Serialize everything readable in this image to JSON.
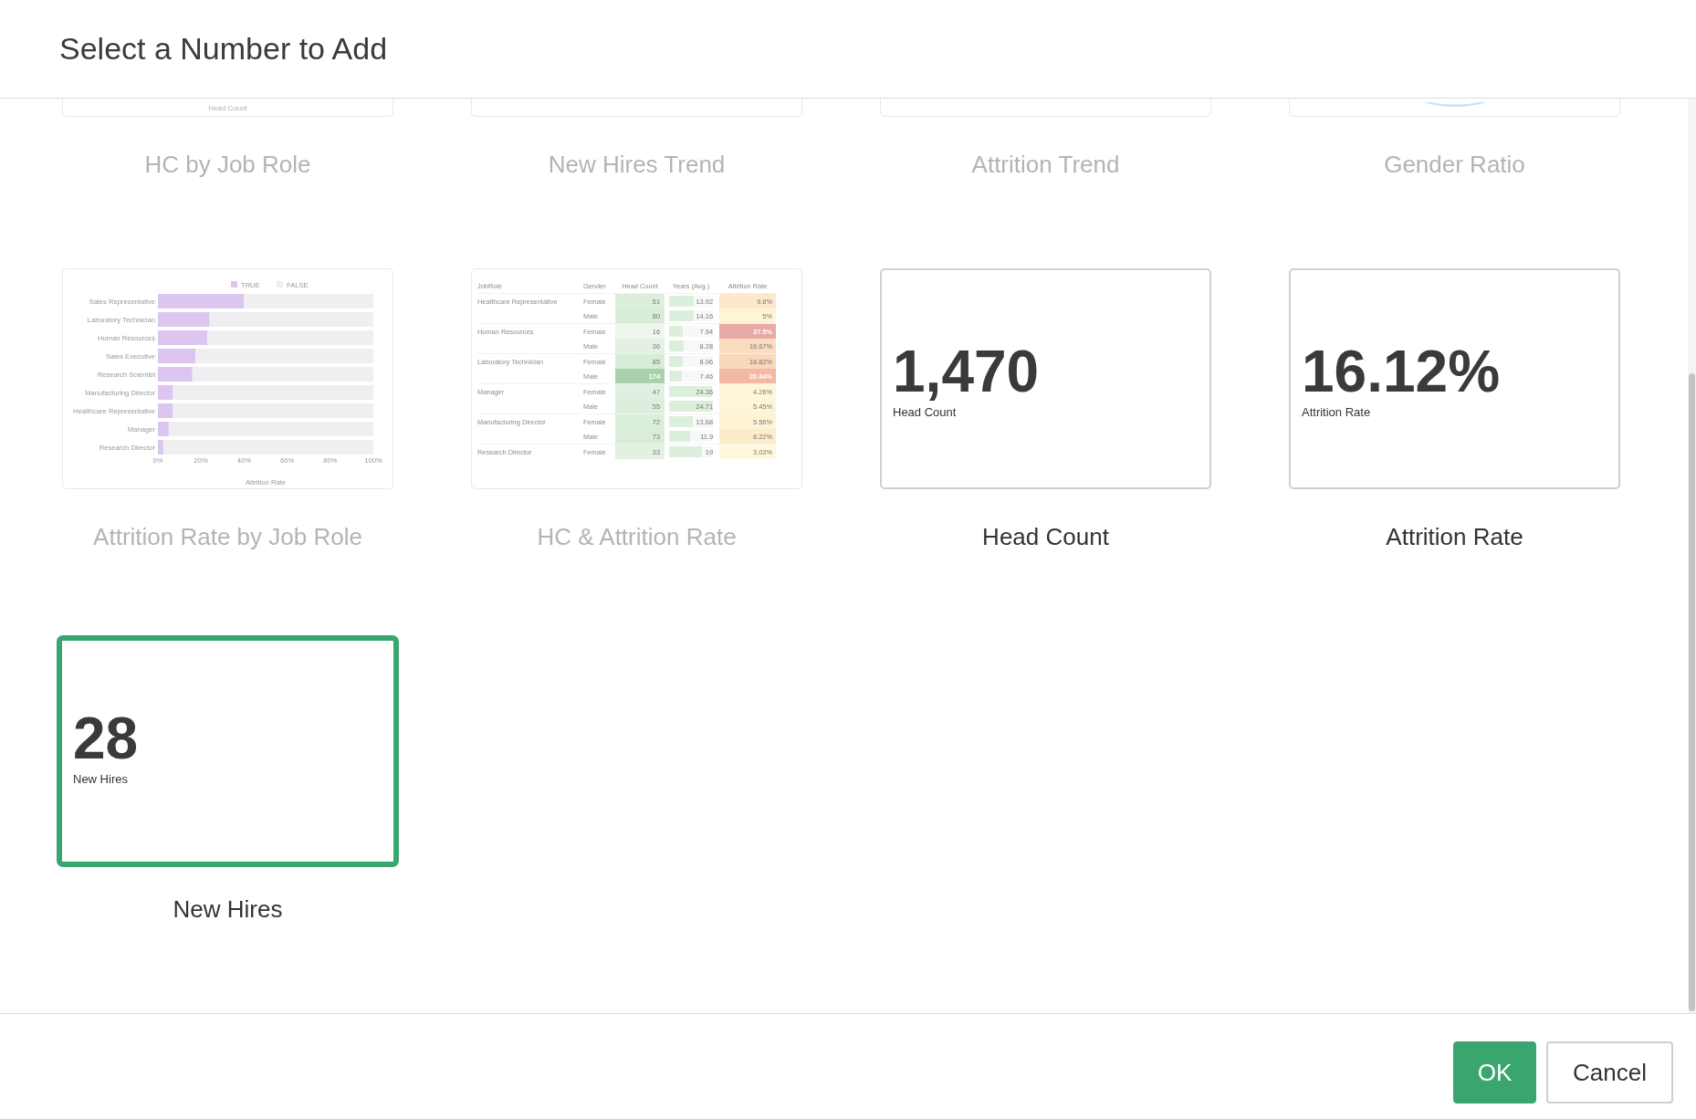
{
  "dialog": {
    "title": "Select a Number to Add"
  },
  "cards": [
    {
      "title": "HC by Job Role",
      "kind": "cut_text",
      "caption": "Head Count",
      "disabled": true,
      "selected": false
    },
    {
      "title": "New Hires Trend",
      "kind": "cut_blank",
      "disabled": true,
      "selected": false
    },
    {
      "title": "Attrition Trend",
      "kind": "cut_blank",
      "disabled": true,
      "selected": false
    },
    {
      "title": "Gender Ratio",
      "kind": "cut_donut",
      "disabled": true,
      "selected": false
    },
    {
      "title": "Attrition Rate by Job Role",
      "kind": "bar_chart",
      "disabled": true,
      "selected": false,
      "chart_data": {
        "type": "bar",
        "orientation": "horizontal",
        "stacked": true,
        "legend": true,
        "xlabel": "Attrition Rate",
        "categories": [
          "Sales Representative",
          "Laboratory Technician",
          "Human Resources",
          "Sales Executive",
          "Research Scientist",
          "Manufacturing Director",
          "Healthcare Representative",
          "Manager",
          "Research Director"
        ],
        "series": [
          {
            "name": "TRUE",
            "color": "#dcc6f0",
            "values": [
              40,
              24,
              23,
              17.5,
              16,
              7,
              7,
              5,
              2.5
            ]
          },
          {
            "name": "FALSE",
            "color": "#efeff1",
            "values": [
              60,
              76,
              77,
              82.5,
              84,
              93,
              93,
              95,
              97.5
            ]
          }
        ],
        "xlim": [
          0,
          100
        ],
        "xticks": [
          {
            "value": 0,
            "label": "0%"
          },
          {
            "value": 20,
            "label": "20%"
          },
          {
            "value": 40,
            "label": "40%"
          },
          {
            "value": 60,
            "label": "60%"
          },
          {
            "value": 80,
            "label": "80%"
          },
          {
            "value": 100,
            "label": "100%"
          }
        ]
      }
    },
    {
      "title": "HC & Attrition Rate",
      "kind": "table",
      "disabled": true,
      "selected": false,
      "table": {
        "columns": [
          "JobRole",
          "Gender",
          "Head Count",
          "Years (Avg.)",
          "Attrition Rate"
        ],
        "rows": [
          {
            "job_role": "Healthcare Representative",
            "gender": "Female",
            "head_count": {
              "text": "51",
              "color": "#dcefdc",
              "dark": false
            },
            "years": {
              "text": "13.92",
              "level": 0.56
            },
            "attrition": {
              "text": "9.8%",
              "color": "#fde9c9",
              "dark": false
            }
          },
          {
            "gender": "Male",
            "head_count": {
              "text": "80",
              "color": "#d8edd8",
              "dark": false
            },
            "years": {
              "text": "14.16",
              "level": 0.57
            },
            "attrition": {
              "text": "5%",
              "color": "#fef5d6",
              "dark": false
            }
          },
          {
            "job_role": "Human Resources",
            "gender": "Female",
            "head_count": {
              "text": "16",
              "color": "#eef6ee",
              "dark": false
            },
            "years": {
              "text": "7.94",
              "level": 0.32
            },
            "attrition": {
              "text": "37.5%",
              "color": "#e9a9a6",
              "dark": true
            }
          },
          {
            "gender": "Male",
            "head_count": {
              "text": "36",
              "color": "#e2f1e2",
              "dark": false
            },
            "years": {
              "text": "8.28",
              "level": 0.33
            },
            "attrition": {
              "text": "16.67%",
              "color": "#fadcbf",
              "dark": false
            }
          },
          {
            "job_role": "Laboratory Technician",
            "gender": "Female",
            "head_count": {
              "text": "85",
              "color": "#d6ecd6",
              "dark": false
            },
            "years": {
              "text": "8.06",
              "level": 0.32
            },
            "attrition": {
              "text": "18.82%",
              "color": "#f9d7bb",
              "dark": false
            }
          },
          {
            "gender": "Male",
            "head_count": {
              "text": "174",
              "color": "#a9d1ac",
              "dark": true
            },
            "years": {
              "text": "7.46",
              "level": 0.3
            },
            "attrition": {
              "text": "20.44%",
              "color": "#f3b9a4",
              "dark": true
            }
          },
          {
            "job_role": "Manager",
            "gender": "Female",
            "head_count": {
              "text": "47",
              "color": "#e0f0e0",
              "dark": false
            },
            "years": {
              "text": "24.36",
              "level": 0.97
            },
            "attrition": {
              "text": "4.26%",
              "color": "#fef6d8",
              "dark": false
            }
          },
          {
            "gender": "Male",
            "head_count": {
              "text": "55",
              "color": "#ddeedd",
              "dark": false
            },
            "years": {
              "text": "24.71",
              "level": 0.99
            },
            "attrition": {
              "text": "5.45%",
              "color": "#fef5d6",
              "dark": false
            }
          },
          {
            "job_role": "Manufacturing Director",
            "gender": "Female",
            "head_count": {
              "text": "72",
              "color": "#daeeda",
              "dark": false
            },
            "years": {
              "text": "13.68",
              "level": 0.55
            },
            "attrition": {
              "text": "5.56%",
              "color": "#fef4d5",
              "dark": false
            }
          },
          {
            "gender": "Male",
            "head_count": {
              "text": "73",
              "color": "#d9edd9",
              "dark": false
            },
            "years": {
              "text": "11.9",
              "level": 0.48
            },
            "attrition": {
              "text": "8.22%",
              "color": "#fdecca",
              "dark": false
            }
          },
          {
            "job_role": "Research Director",
            "gender": "Female",
            "head_count": {
              "text": "33",
              "color": "#e3f1e3",
              "dark": false
            },
            "years": {
              "text": "19",
              "level": 0.76
            },
            "attrition": {
              "text": "3.03%",
              "color": "#fef8dc",
              "dark": false
            }
          }
        ]
      }
    },
    {
      "title": "Head Count",
      "kind": "number",
      "value": "1,470",
      "caption": "Head Count",
      "disabled": false,
      "selected": false
    },
    {
      "title": "Attrition Rate",
      "kind": "number",
      "value": "16.12%",
      "caption": "Attrition Rate",
      "disabled": false,
      "selected": false
    },
    {
      "title": "New Hires",
      "kind": "number",
      "value": "28",
      "caption": "New Hires",
      "disabled": false,
      "selected": true
    }
  ],
  "buttons": [
    {
      "label": "OK",
      "kind": "primary"
    },
    {
      "label": "Cancel",
      "kind": "secondary"
    }
  ]
}
